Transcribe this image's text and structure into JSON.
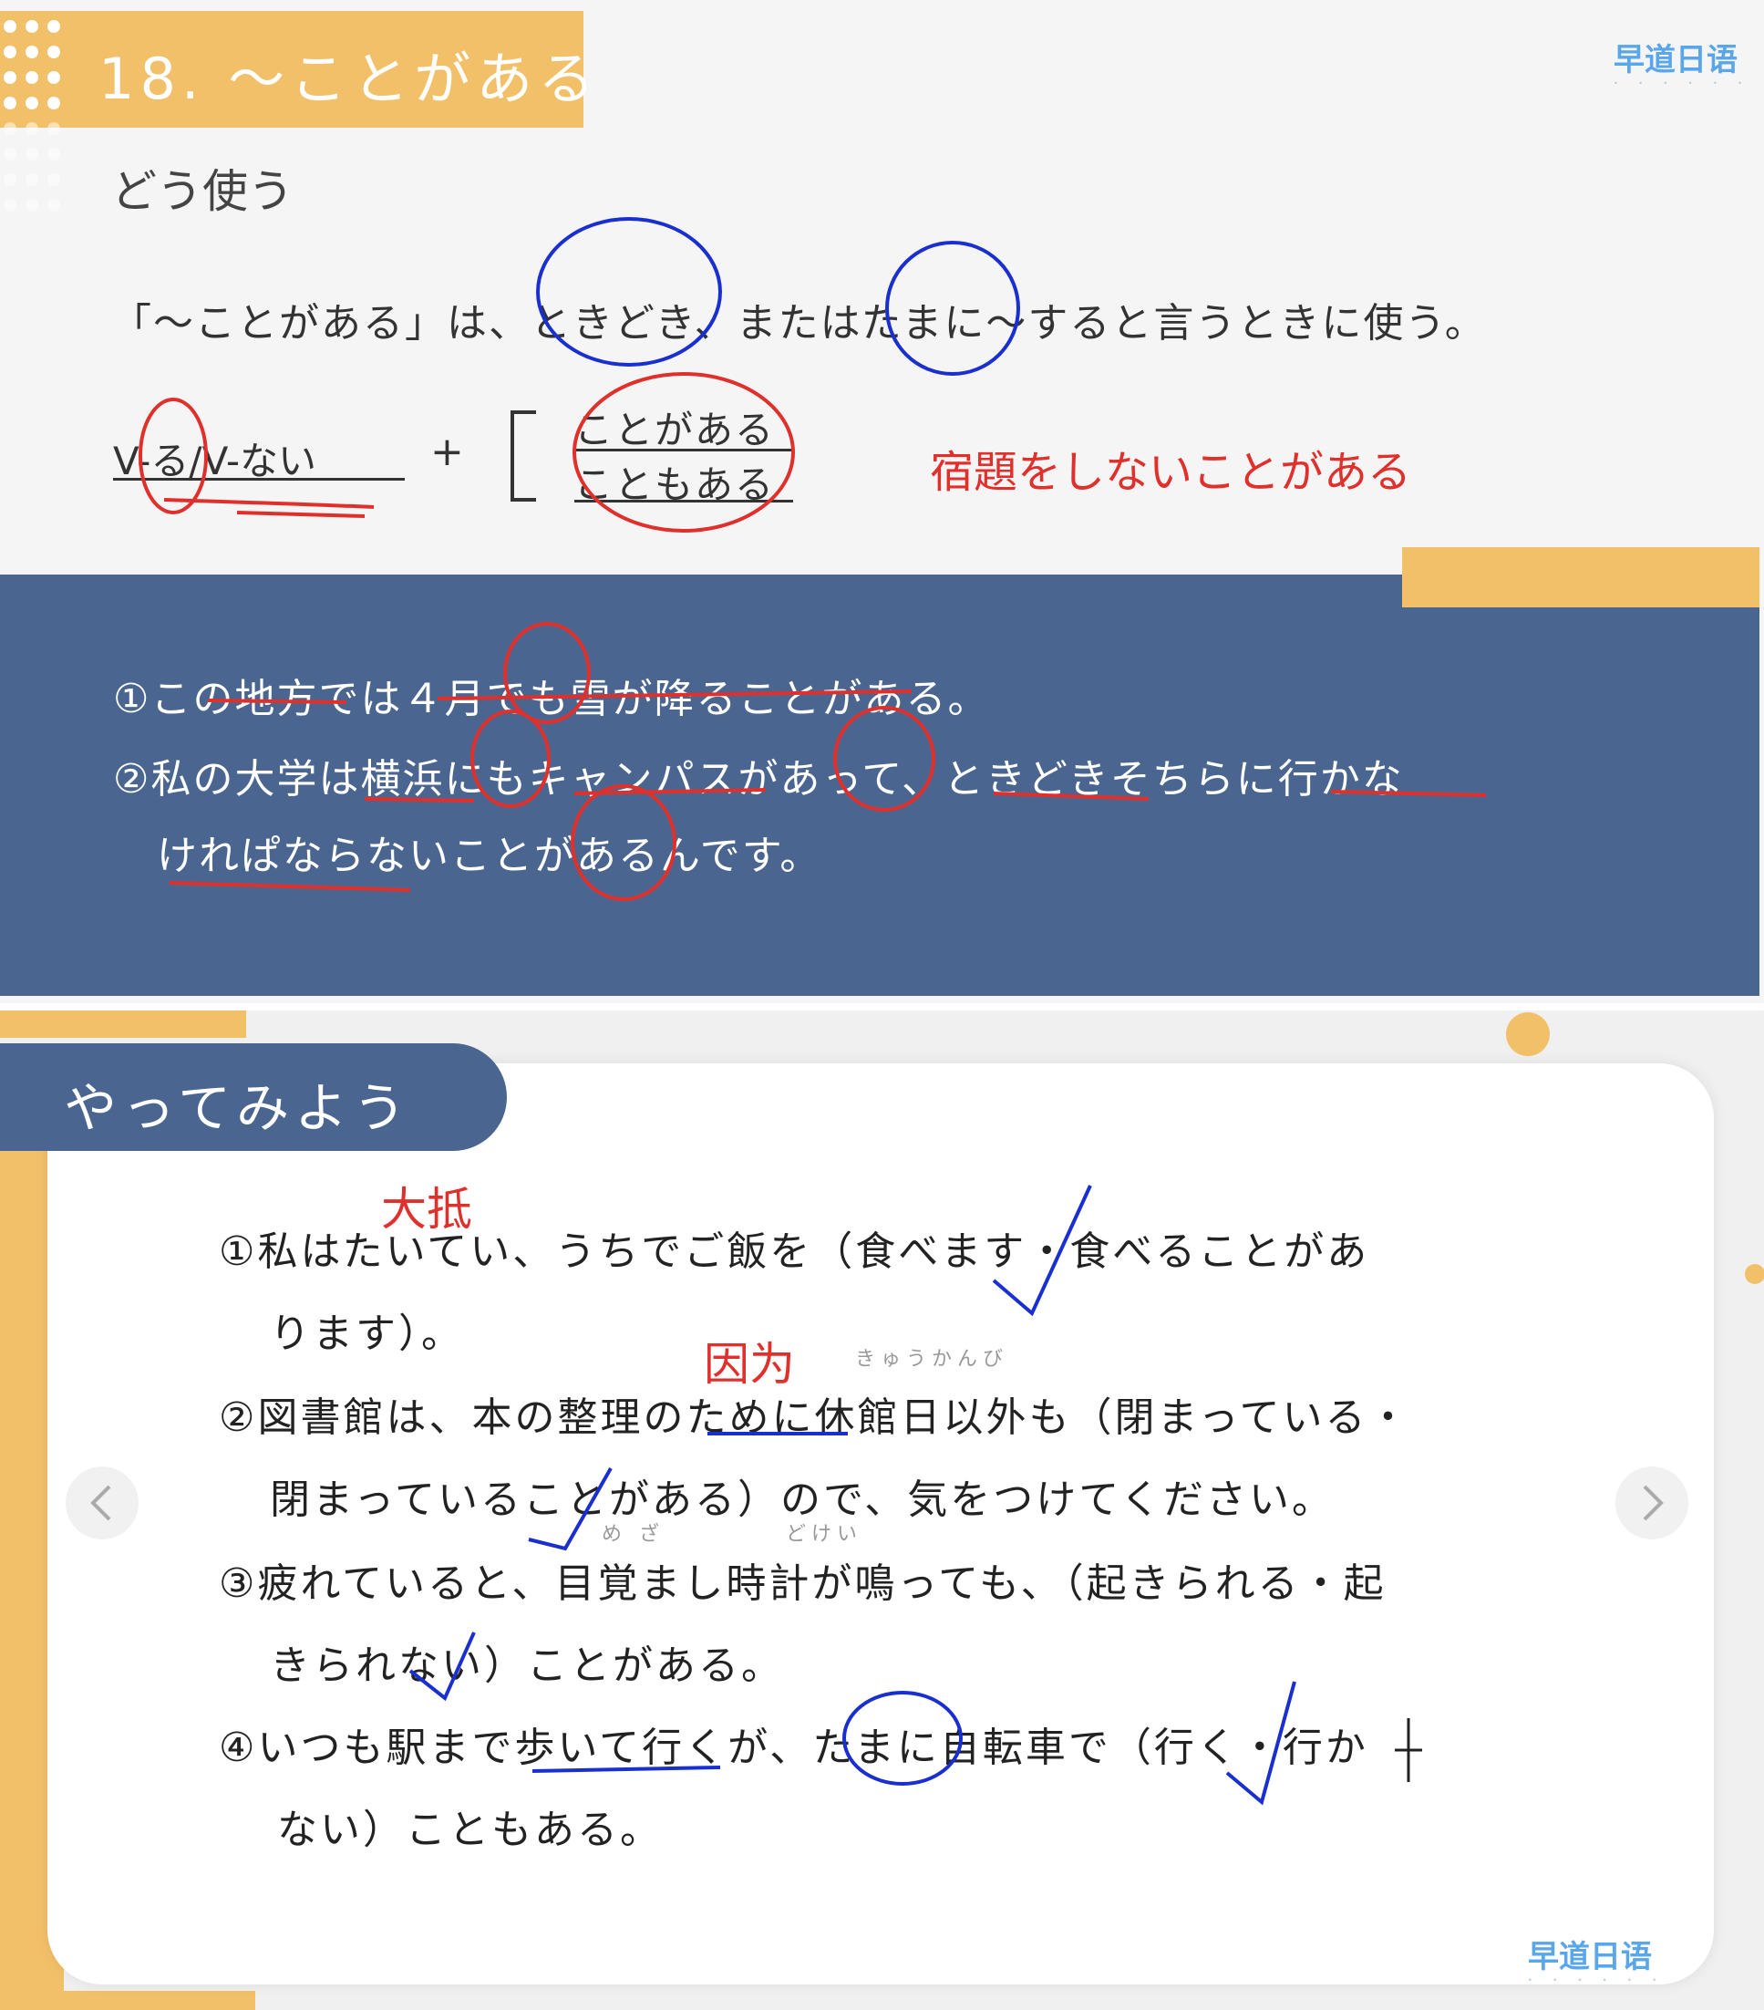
{
  "slide1": {
    "title": "18. ～ことがある",
    "logo": "早道日语",
    "subheading": "どう使う",
    "explanation": "「～ことがある」は、ときどき、またはたまに～すると言うときに使う。",
    "formula": "V-る/V-ない",
    "plus": "+",
    "pattern_1": "ことがある",
    "pattern_2": "こともある",
    "example_red": "宿題をしないことがある",
    "examples": [
      "①この地方では４月でも雪が降ることがある。",
      "②私の大学は横浜にもキャンパスがあって、ときどきそちらに行かな",
      "けれぱならないことがあるんです。"
    ]
  },
  "slide2": {
    "header": "やってみよう",
    "logo": "早道日语",
    "notes": {
      "q1": "大抵",
      "q2": "因为"
    },
    "ruby": {
      "q2": "きゅうかんび",
      "q3a": "め ざ",
      "q3b": "どけい"
    },
    "questions": [
      "①私はたいてい、うちでご飯を（食べます・食べることがあ",
      "ります）。",
      "②図書館は、本の整理のために休館日以外も（閉まっている・",
      "閉まっていることがある）ので、気をつけてください。",
      "③疲れていると、目覚まし時計が鳴っても、（起きられる・起",
      "きられない）ことがある。",
      "④いつも駅まで歩いて行くが、たまに自転車で（行く・行か",
      "ない）こともある。"
    ],
    "nav": {
      "prev": "previous",
      "next": "next"
    }
  },
  "colors": {
    "accent_yellow": "#f3c06a",
    "panel_blue": "#4a6690",
    "annotation_red": "#e0302c",
    "annotation_blue": "#1a2fd0",
    "logo_blue": "#5aa6ea"
  }
}
